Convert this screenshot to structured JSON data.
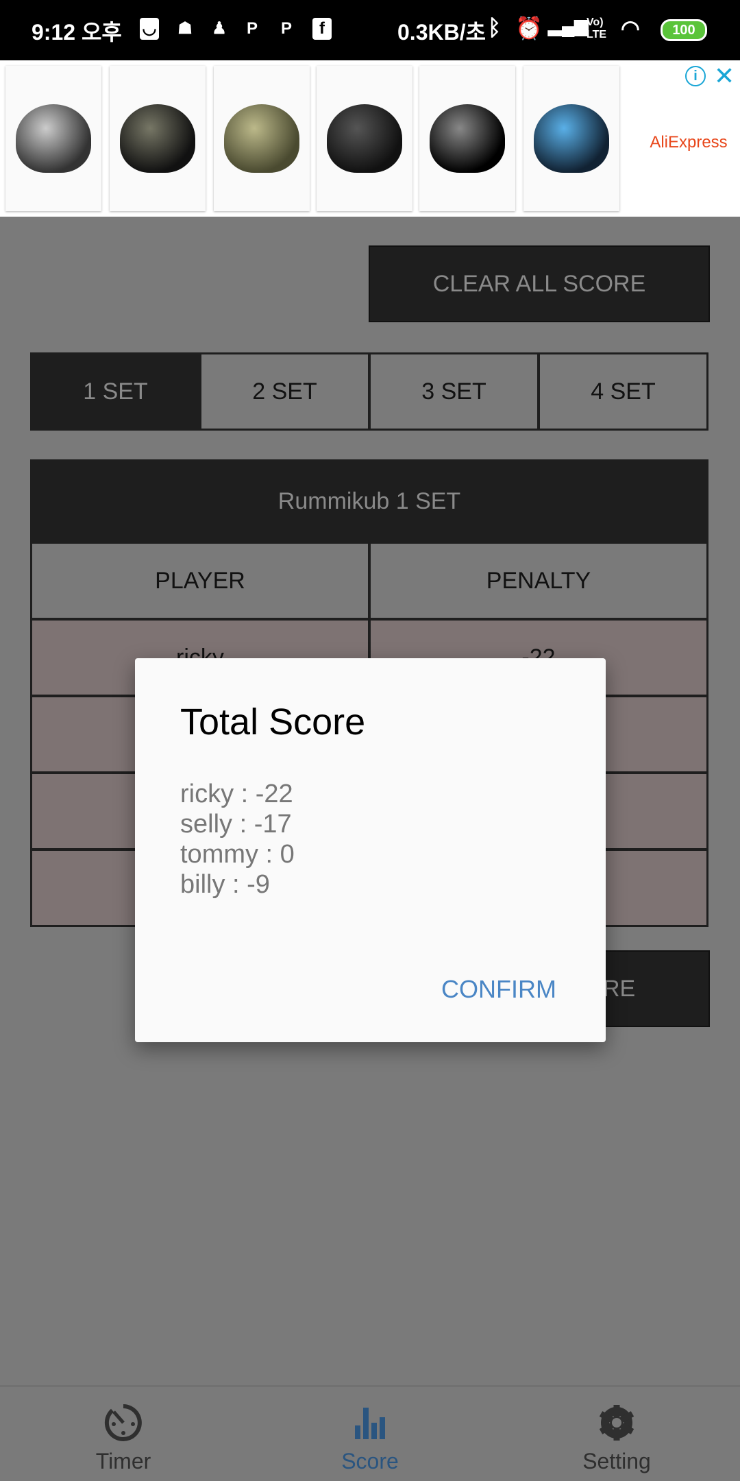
{
  "status_bar": {
    "time": "9:12 오후",
    "network_speed": "0.3KB/초",
    "battery": "100",
    "notification_icons": [
      "shopping-bag-icon",
      "robot-icon",
      "figure-icon",
      "p-icon",
      "p-icon",
      "facebook-icon"
    ],
    "system_icons": [
      "bluetooth-icon",
      "alarm-icon",
      "signal-icon",
      "volte-icon",
      "wifi-icon",
      "battery-icon"
    ]
  },
  "ad": {
    "brand": "AliExpress",
    "tiles": 6
  },
  "clear_all_label": "CLEAR ALL SCORE",
  "tabs": [
    {
      "label": "1 SET",
      "active": true
    },
    {
      "label": "2 SET"
    },
    {
      "label": "3 SET"
    },
    {
      "label": "4 SET"
    }
  ],
  "table": {
    "title": "Rummikub 1 SET",
    "headers": [
      "PLAYER",
      "PENALTY"
    ],
    "rows": [
      [
        "ricky",
        "-22"
      ],
      [
        "",
        ""
      ],
      [
        "",
        ""
      ],
      [
        "",
        ""
      ]
    ]
  },
  "bottom_button_visible_text": "RE",
  "dialog": {
    "title": "Total Score",
    "lines": [
      "ricky : -22",
      "selly : -17",
      "tommy : 0",
      "billy : -9"
    ],
    "confirm": "CONFIRM"
  },
  "nav": [
    {
      "label": "Timer",
      "icon": "timer-icon"
    },
    {
      "label": "Score",
      "icon": "bar-chart-icon",
      "active": true
    },
    {
      "label": "Setting",
      "icon": "gear-icon"
    }
  ],
  "colors": {
    "accent": "#4a86c5",
    "nav_active": "#2a5580"
  }
}
